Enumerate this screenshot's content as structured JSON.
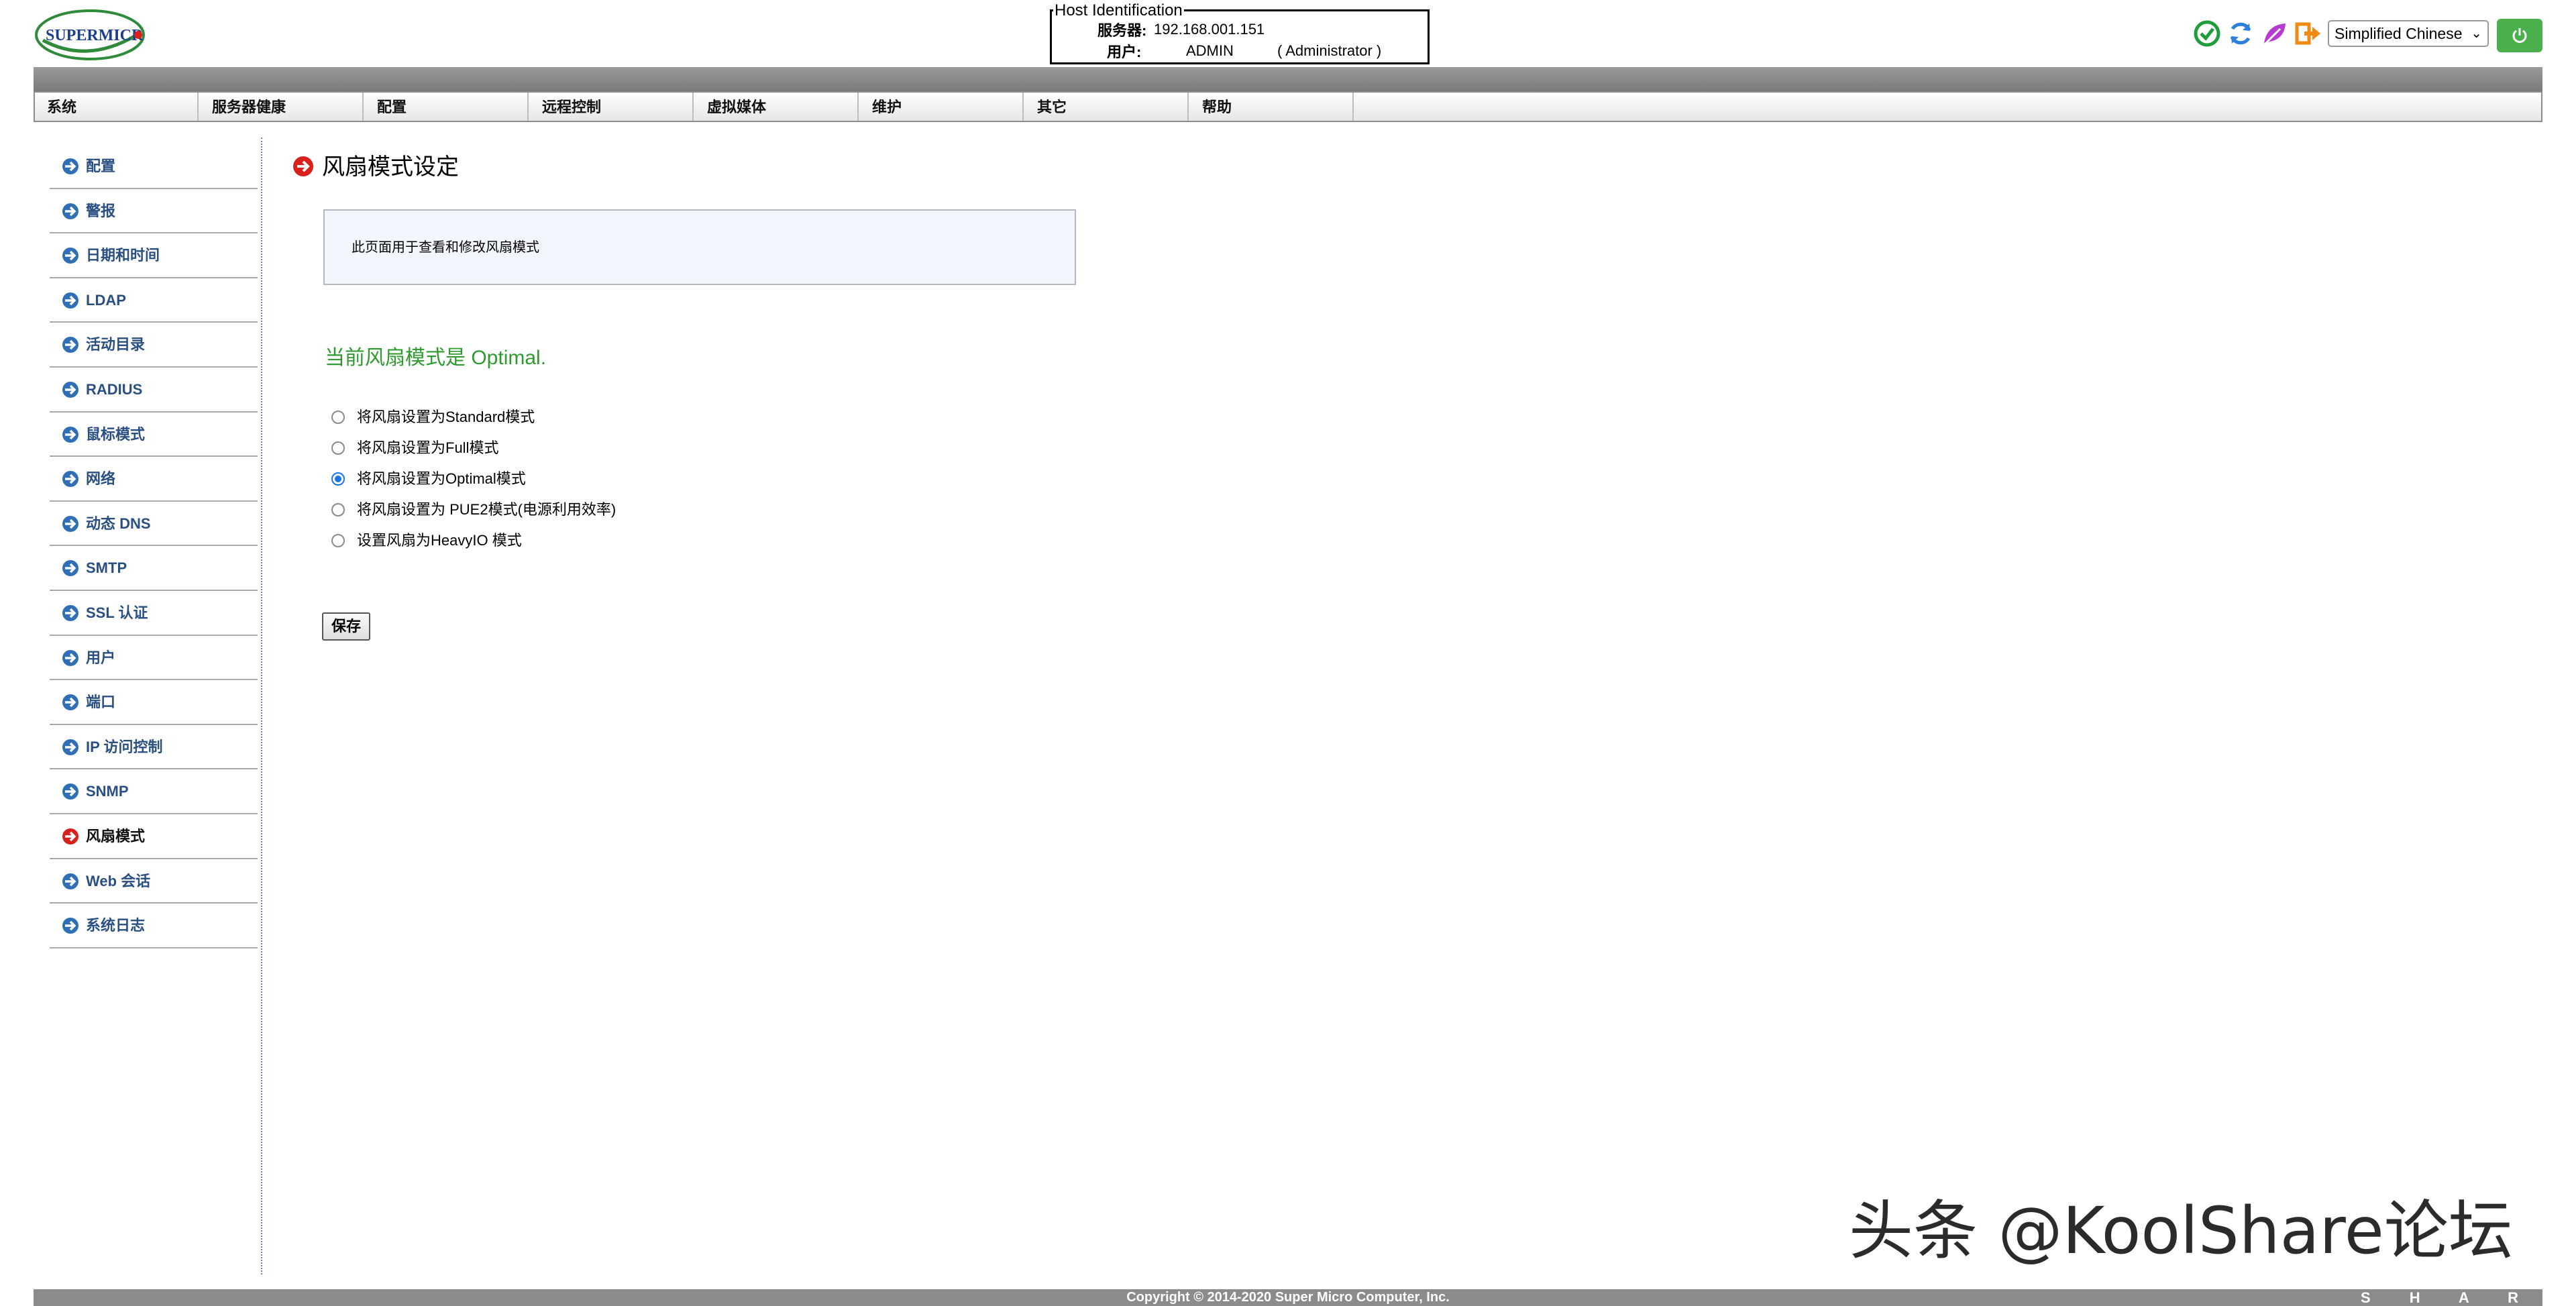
{
  "header": {
    "logo_text": "SUPERMICRO",
    "host_box": {
      "legend": "Host Identification",
      "server_label": "服务器:",
      "server_value": "192.168.001.151",
      "user_label": "用户:",
      "user_value": "ADMIN",
      "user_role": "( Administrator )"
    },
    "icons": [
      "check-circle-icon",
      "refresh-icon",
      "leaf-icon",
      "logout-icon"
    ],
    "language": "Simplified Chinese",
    "power_icon": "power-icon"
  },
  "nav": {
    "items": [
      "系统",
      "服务器健康",
      "配置",
      "远程控制",
      "虚拟媒体",
      "维护",
      "其它",
      "帮助"
    ]
  },
  "sidebar": {
    "items": [
      {
        "label": "配置",
        "active": false
      },
      {
        "label": "警报",
        "active": false
      },
      {
        "label": "日期和时间",
        "active": false
      },
      {
        "label": "LDAP",
        "active": false
      },
      {
        "label": "活动目录",
        "active": false
      },
      {
        "label": "RADIUS",
        "active": false
      },
      {
        "label": "鼠标模式",
        "active": false
      },
      {
        "label": "网络",
        "active": false
      },
      {
        "label": "动态 DNS",
        "active": false
      },
      {
        "label": "SMTP",
        "active": false
      },
      {
        "label": "SSL 认证",
        "active": false
      },
      {
        "label": "用户",
        "active": false
      },
      {
        "label": "端口",
        "active": false
      },
      {
        "label": "IP 访问控制",
        "active": false
      },
      {
        "label": "SNMP",
        "active": false
      },
      {
        "label": "风扇模式",
        "active": true
      },
      {
        "label": "Web 会话",
        "active": false
      },
      {
        "label": "系统日志",
        "active": false
      }
    ]
  },
  "main": {
    "title": "风扇模式设定",
    "info": "此页面用于查看和修改风扇模式",
    "status": "当前风扇模式是 Optimal.",
    "options": [
      {
        "label": "将风扇设置为Standard模式",
        "checked": false
      },
      {
        "label": "将风扇设置为Full模式",
        "checked": false
      },
      {
        "label": "将风扇设置为Optimal模式",
        "checked": true
      },
      {
        "label": "将风扇设置为 PUE2模式(电源利用效率)",
        "checked": false
      },
      {
        "label": "设置风扇为HeavyIO 模式",
        "checked": false
      }
    ],
    "save_label": "保存"
  },
  "watermark": "头条 @KoolShare论坛",
  "footer": {
    "copyright": "Copyright © 2014-2020 Super Micro Computer, Inc.",
    "share": "S H A R"
  },
  "colors": {
    "link": "#2a4f82",
    "status_green": "#2e9b2e",
    "power_green": "#49b04b",
    "active_red": "#d9201a",
    "bullet_blue": "#2f6fb5"
  }
}
